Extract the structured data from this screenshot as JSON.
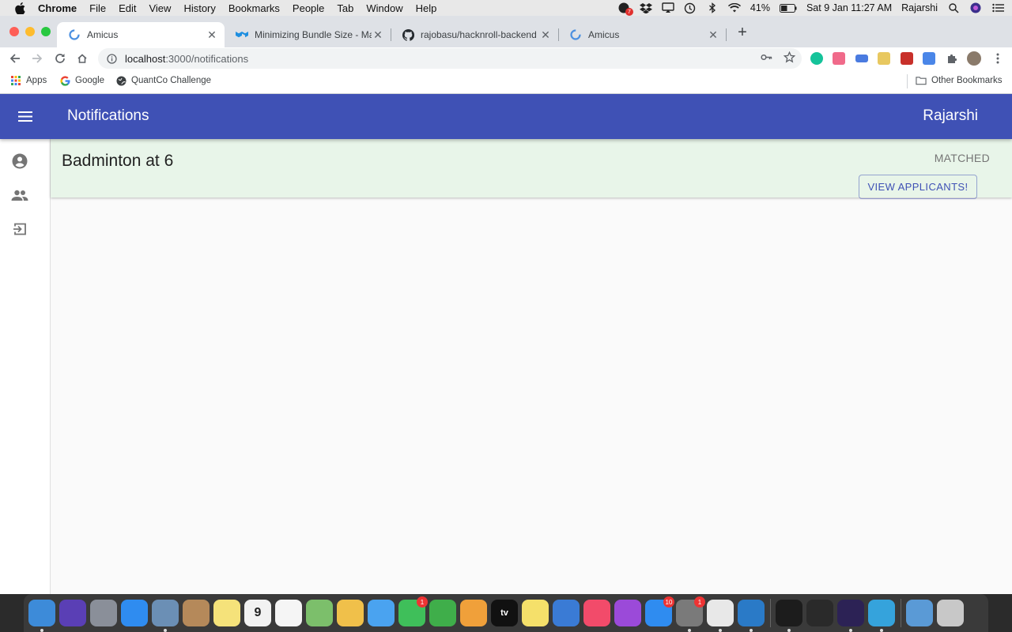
{
  "menubar": {
    "app_name": "Chrome",
    "items": [
      "File",
      "Edit",
      "View",
      "History",
      "Bookmarks",
      "People",
      "Tab",
      "Window",
      "Help"
    ],
    "battery": "41%",
    "datetime": "Sat 9 Jan  11:27 AM",
    "user": "Rajarshi",
    "notification_badge": "7"
  },
  "browser": {
    "tabs": [
      {
        "title": "Amicus",
        "icon": "amicus-favicon",
        "active": true
      },
      {
        "title": "Minimizing Bundle Size - Mater",
        "icon": "mui-favicon",
        "active": false
      },
      {
        "title": "rajobasu/hacknroll-backend",
        "icon": "github-favicon",
        "active": false
      },
      {
        "title": "Amicus",
        "icon": "amicus-favicon",
        "active": false
      }
    ],
    "url_host": "localhost",
    "url_path": ":3000/notifications",
    "bookmarks": [
      {
        "label": "Apps",
        "icon": "apps-grid-icon"
      },
      {
        "label": "Google",
        "icon": "google-icon"
      },
      {
        "label": "QuantCo Challenge",
        "icon": "globe-icon"
      }
    ],
    "other_bookmarks": "Other Bookmarks"
  },
  "app": {
    "title": "Notifications",
    "user": "Rajarshi",
    "primary_color": "#3f51b5",
    "drawer_items": [
      "account-circle-icon",
      "people-icon",
      "exit-icon"
    ],
    "notifications": [
      {
        "event": "Badminton at 6",
        "status": "MATCHED",
        "action": "VIEW APPLICANTS!",
        "background": "#e8f5e9"
      }
    ]
  },
  "dock": {
    "items": [
      {
        "name": "finder",
        "color": "#3d8bd9",
        "running": true
      },
      {
        "name": "siri",
        "color": "#5a3fb5",
        "running": false
      },
      {
        "name": "launchpad",
        "color": "#8a8f99",
        "running": false
      },
      {
        "name": "safari",
        "color": "#2f8cf0",
        "running": false
      },
      {
        "name": "preview",
        "color": "#6b8fb5",
        "running": true
      },
      {
        "name": "contacts",
        "color": "#b5895a",
        "running": false
      },
      {
        "name": "notes",
        "color": "#f5e27a",
        "running": false
      },
      {
        "name": "calendar",
        "color": "#f2f2f2",
        "running": false,
        "label": "9"
      },
      {
        "name": "reminders",
        "color": "#f5f5f5",
        "running": false
      },
      {
        "name": "maps",
        "color": "#7cbf6b",
        "running": false
      },
      {
        "name": "photos",
        "color": "#f0c04a",
        "running": false
      },
      {
        "name": "messages",
        "color": "#4aa3f0",
        "running": false
      },
      {
        "name": "facetime",
        "color": "#3fbf5a",
        "running": false,
        "badge": "1"
      },
      {
        "name": "numbers",
        "color": "#3fae4a",
        "running": false
      },
      {
        "name": "pages",
        "color": "#f0a03a",
        "running": false
      },
      {
        "name": "apple-tv",
        "color": "#111111",
        "running": false,
        "label": "tv"
      },
      {
        "name": "stickies",
        "color": "#f5e06a",
        "running": false
      },
      {
        "name": "keynote",
        "color": "#3a7bd5",
        "running": false
      },
      {
        "name": "music",
        "color": "#f24b6a",
        "running": false
      },
      {
        "name": "podcasts",
        "color": "#9b4ad9",
        "running": false
      },
      {
        "name": "app-store",
        "color": "#2f8cf0",
        "running": false,
        "badge": "10"
      },
      {
        "name": "system-preferences",
        "color": "#7a7a7a",
        "running": true,
        "badge": "1"
      },
      {
        "name": "chrome",
        "color": "#e8e8e8",
        "running": true
      },
      {
        "name": "vscode",
        "color": "#2a7ac7",
        "running": true
      },
      {
        "name": "terminal",
        "color": "#1c1c1c",
        "running": true
      },
      {
        "name": "activity-monitor",
        "color": "#2a2a2a",
        "running": false
      },
      {
        "name": "eclipse",
        "color": "#2c2255",
        "running": true
      },
      {
        "name": "telegram",
        "color": "#35a3dc",
        "running": true
      },
      {
        "name": "downloads-folder",
        "color": "#5a9ad6",
        "running": false
      },
      {
        "name": "trash",
        "color": "#c8c8c8",
        "running": false
      }
    ]
  }
}
